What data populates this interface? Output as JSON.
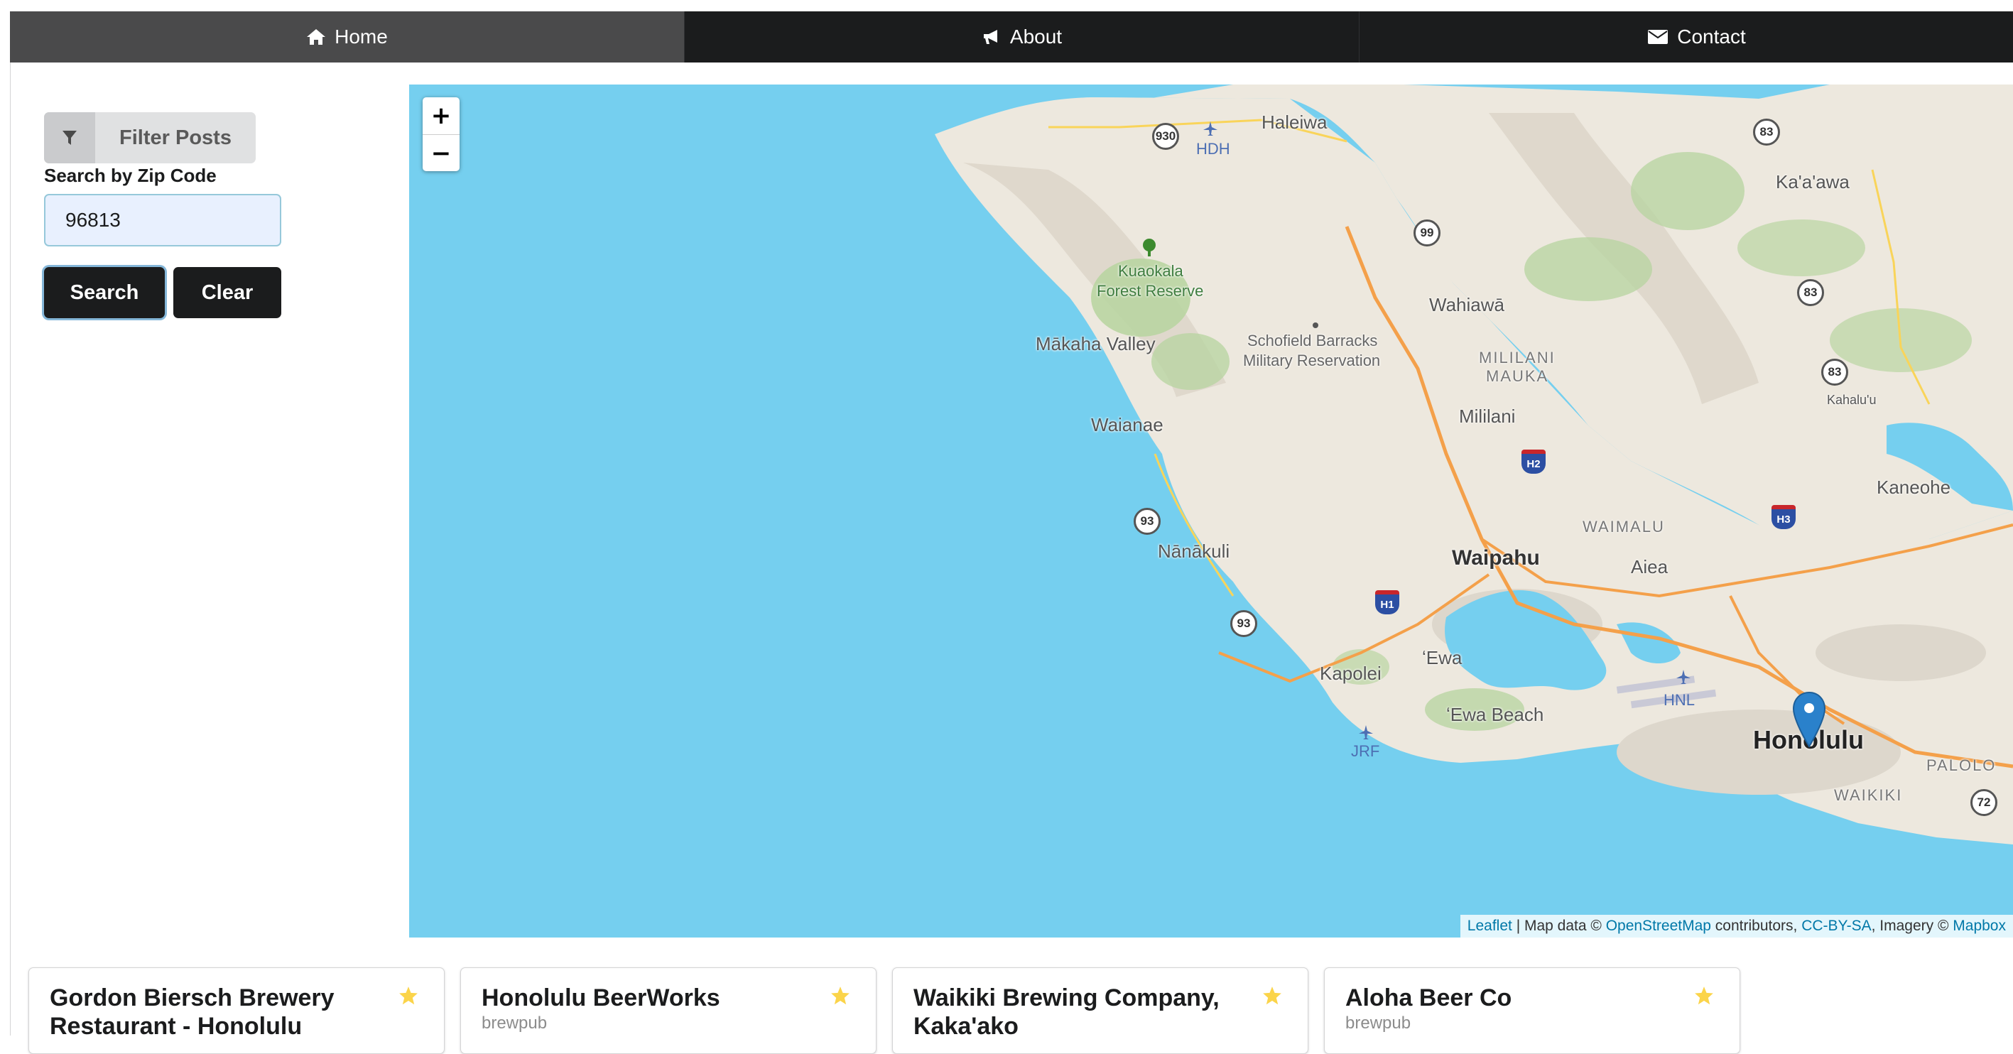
{
  "nav": {
    "items": [
      {
        "label": "Home",
        "icon": "home-icon",
        "active": true
      },
      {
        "label": "About",
        "icon": "bullhorn-icon",
        "active": false
      },
      {
        "label": "Contact",
        "icon": "envelope-icon",
        "active": false
      }
    ]
  },
  "filter": {
    "button_label": "Filter Posts",
    "zip_label": "Search by Zip Code",
    "zip_value": "96813",
    "search_label": "Search",
    "clear_label": "Clear"
  },
  "map": {
    "zoom_in": "+",
    "zoom_out": "−",
    "places": {
      "haleiwa": "Haleiwa",
      "kaaawa": "Ka'a'awa",
      "hdh": "HDH",
      "kuaokala": "Kuaokala",
      "forest_reserve": "Forest Reserve",
      "wahiawa": "Wahiawā",
      "makaha": "Mākaha Valley",
      "schofield1": "Schofield Barracks",
      "schofield2": "Military Reservation",
      "mililani_mauka1": "MILILANI",
      "mililani_mauka2": "MAUKA",
      "mililani": "Mililani",
      "kahaluu": "Kahalu'u",
      "waianae": "Waianae",
      "kaneohe": "Kaneohe",
      "waimalu": "WAIMALU",
      "nanakuli": "Nānākuli",
      "waipahu": "Waipahu",
      "aiea": "Aiea",
      "ewa": "ʻEwa",
      "kapolei": "Kapolei",
      "hnl": "HNL",
      "ewa_beach": "ʻEwa Beach",
      "honolulu": "Honolulu",
      "jrf": "JRF",
      "palolo": "PALOLO",
      "waikiki": "WAIKIKI"
    },
    "shields": {
      "s930": "930",
      "s83a": "83",
      "s99": "99",
      "s83b": "83",
      "s83c": "83",
      "s93a": "93",
      "s93b": "93",
      "s72": "72",
      "h2": "H2",
      "h3": "H3",
      "h1": "H1"
    },
    "attribution": {
      "leaflet": "Leaflet",
      "sep1": " | Map data © ",
      "osm": "OpenStreetMap",
      "mid": " contributors, ",
      "ccbysa": "CC-BY-SA",
      "imagery": ", Imagery © ",
      "mapbox": "Mapbox"
    }
  },
  "cards": [
    {
      "title": "Gordon Biersch Brewery Restaurant - Honolulu",
      "subtitle": ""
    },
    {
      "title": "Honolulu BeerWorks",
      "subtitle": "brewpub"
    },
    {
      "title": "Waikiki Brewing Company, Kaka'ako",
      "subtitle": ""
    },
    {
      "title": "Aloha Beer Co",
      "subtitle": "brewpub"
    }
  ],
  "colors": {
    "nav_bg": "#1b1c1d",
    "nav_active": "#4a4a4b",
    "water": "#75cfef",
    "land": "#ede8de",
    "star": "#fbd44a",
    "marker": "#2a81cb"
  }
}
